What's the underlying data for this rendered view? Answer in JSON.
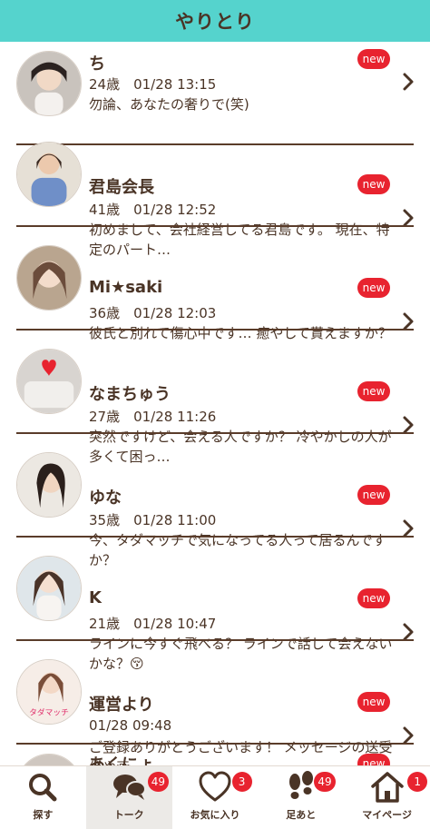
{
  "header": {
    "title": "やりとり"
  },
  "messages": [
    {
      "name": "ち",
      "meta": "24歳　01/28 13:15",
      "text": "勿論、あなたの奢りで(笑)",
      "badge": "new"
    },
    {
      "name": "君島会長",
      "meta": "41歳　01/28 12:52",
      "text": "初めまして、会社経営してる君島です。 現在、特定のパート…",
      "badge": "new"
    },
    {
      "name": "Mi★saki",
      "meta": "36歳　01/28 12:03",
      "text": "彼氏と別れて傷心中です… 癒やして貰えますか？",
      "badge": "new"
    },
    {
      "name": "なまちゅう",
      "meta": "27歳　01/28 11:26",
      "text": "突然ですけど、会える人ですか？ 冷やかしの人が多くて困っ…",
      "badge": "new"
    },
    {
      "name": "ゆな",
      "meta": "35歳　01/28 11:00",
      "text": "今、タダマッチで気になってる人って居るんですか？",
      "badge": "new"
    },
    {
      "name": "K",
      "meta": "21歳　01/28 10:47",
      "text": "ラインに今すぐ飛べる？ ラインで話して会えないかな？😚",
      "badge": "new"
    },
    {
      "name": "運営より",
      "meta": "01/28 09:48",
      "text": "ご登録ありがとうございます！ メッセージの送受信や画…",
      "badge": "new",
      "avatar_text": "タダマッチ"
    },
    {
      "name": "あくにょ",
      "meta": "",
      "text": "",
      "badge": "new"
    }
  ],
  "tabs": [
    {
      "label": "探す",
      "icon": "search-icon",
      "badge": ""
    },
    {
      "label": "トーク",
      "icon": "chat-bubbles-icon",
      "badge": "49"
    },
    {
      "label": "お気に入り",
      "icon": "heart-icon",
      "badge": "3"
    },
    {
      "label": "足あと",
      "icon": "footprints-icon",
      "badge": "49"
    },
    {
      "label": "マイページ",
      "icon": "home-icon",
      "badge": "1"
    }
  ],
  "colors": {
    "header_bg": "#55d3cd",
    "badge_red": "#e8232f",
    "text_brown": "#4a3426",
    "active_tab_bg": "#eceae7"
  }
}
